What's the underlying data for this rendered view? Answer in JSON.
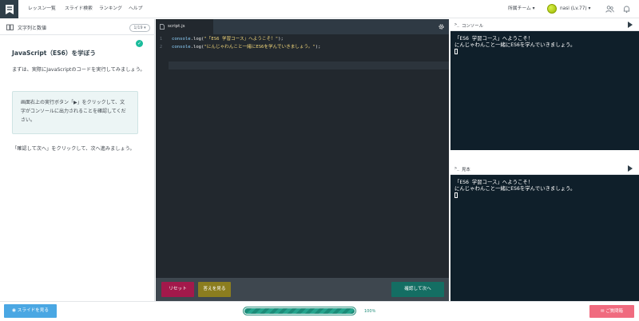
{
  "nav": {
    "links": [
      "レッスン一覧",
      "スライド検索",
      "ランキング",
      "ヘルプ"
    ],
    "team": "所属チーム ▾",
    "user": "nasi (Lv.77) ▾"
  },
  "lesson": {
    "title": "文字列と数値",
    "page": "1/19 ▾",
    "slide_title": "JavaScript（ES6）を学ぼう",
    "para1": "まずは、実際にJavaScriptのコードを実行してみましょう。",
    "note": "画面右上の実行ボタン「▶」をクリックして、文字がコンソールに出力されることを確認してください。",
    "para2": "「確認して次へ」をクリックして、次へ進みましょう。"
  },
  "editor": {
    "tab": "script.js",
    "lines": [
      {
        "no": "1",
        "fn": "console",
        "rest": ".log(",
        "str": "\"「ES6 学習コース」へようこそ！\"",
        "end": ");"
      },
      {
        "no": "2",
        "fn": "console",
        "rest": ".log(",
        "str": "\"にんじゃわんこと一緒にES6を学んでいきましょう。\"",
        "end": ");"
      }
    ],
    "reset": "リセット",
    "answer": "答えを見る",
    "next": "確認して次へ"
  },
  "console": {
    "label": "コンソール",
    "prompt": ">_",
    "lines": [
      "「ES6 学習コース」へようこそ！",
      "にんじゃわんこと一緒にES6を学んでいきましょう。"
    ]
  },
  "sample": {
    "label": "見本",
    "prompt": ">_",
    "lines": [
      "「ES6 学習コース」へようこそ！",
      "にんじゃわんこと一緒にES6を学んでいきましょう。"
    ]
  },
  "bottom": {
    "slide_button": "スライドを見る",
    "progress": 1.0,
    "progress_text": "100％",
    "question_button": "ご質問箱"
  },
  "colors": {
    "header_dark": "#2f3e48",
    "console_bg": "#0f1f2a",
    "editor_bg": "#22282e",
    "reset_button": "#a3194b",
    "answer_button": "#8b7d1f",
    "next_button": "#146e63",
    "progress": "#1c8b78",
    "slide_button": "#4aa7e3",
    "question_button": "#f06b7f"
  }
}
